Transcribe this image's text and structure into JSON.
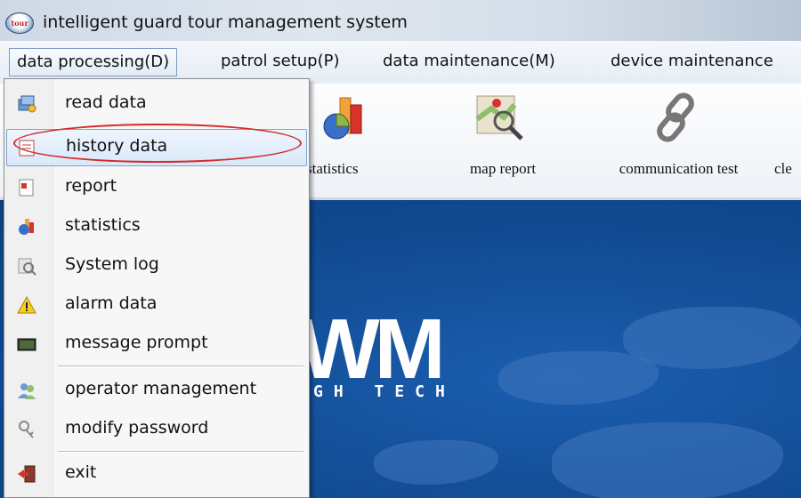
{
  "window": {
    "title": "intelligent guard tour management system",
    "icon_text": "tour"
  },
  "menubar": {
    "items": [
      {
        "label": "data processing(D)"
      },
      {
        "label": "patrol setup(P)"
      },
      {
        "label": "data maintenance(M)"
      },
      {
        "label": "device maintenance"
      }
    ]
  },
  "toolbar": {
    "buttons": [
      {
        "label": "statistics",
        "icon": "statistics-icon"
      },
      {
        "label": "map report",
        "icon": "map-report-icon"
      },
      {
        "label": "communication test",
        "icon": "link-icon"
      },
      {
        "label": "cle"
      }
    ]
  },
  "splash": {
    "logo": "WM",
    "tagline": "GH TECH"
  },
  "dropdown": {
    "items": [
      {
        "label": "read data",
        "icon": "read-data-icon"
      },
      {
        "label": "history data",
        "icon": "history-data-icon"
      },
      {
        "label": "report",
        "icon": "report-icon"
      },
      {
        "label": "statistics",
        "icon": "statistics-icon"
      },
      {
        "label": "System log",
        "icon": "system-log-icon"
      },
      {
        "label": "alarm data",
        "icon": "alarm-warning-icon"
      },
      {
        "label": "message prompt",
        "icon": "message-icon"
      },
      {
        "label": "operator management",
        "icon": "operators-icon"
      },
      {
        "label": "modify password",
        "icon": "key-icon"
      },
      {
        "label": "exit",
        "icon": "exit-door-icon"
      }
    ]
  },
  "colors": {
    "highlight_ellipse": "#d42a2a",
    "splash_blue": "#14509a",
    "hover_border": "#7da2ce"
  }
}
